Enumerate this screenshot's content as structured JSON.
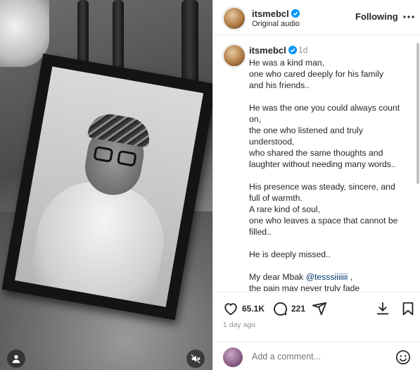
{
  "header": {
    "username": "itsmebcl",
    "audio": "Original audio",
    "follow_label": "Following"
  },
  "caption": {
    "username": "itsmebcl",
    "time_ago": "1d",
    "text_before_mention": "He was a kind man,\none who cared deeply for his family\nand his friends..\n\nHe was the one you could always count\non,\nthe one who listened and truly\nunderstood,\nwho shared the same thoughts and\nlaughter without needing many words..\n\nHis presence was steady, sincere, and\nfull of warmth.\nA rare kind of soul,\none who leaves a space that cannot be\nfilled..\n\nHe is deeply missed..\n\nMy dear Mbak ",
    "mention": "@tesssiiiiiii",
    "text_after_mention": " ,\nthe pain may never truly fade"
  },
  "actions": {
    "likes": "65.1K",
    "comments": "221",
    "posted": "1 day ago"
  },
  "comment_box": {
    "placeholder": "Add a comment..."
  },
  "icons": {
    "verified": "verified-badge-icon",
    "more": "more-options-icon",
    "like": "heart-icon",
    "comment": "comment-bubble-icon",
    "share": "paper-plane-icon",
    "download": "download-icon",
    "save": "bookmark-icon",
    "emoji": "emoji-icon",
    "profile": "person-icon",
    "mute": "muted-speaker-icon"
  },
  "colors": {
    "verified_blue": "#0095f6",
    "mention_link": "#00376b",
    "muted_text": "#8e8e8e"
  }
}
